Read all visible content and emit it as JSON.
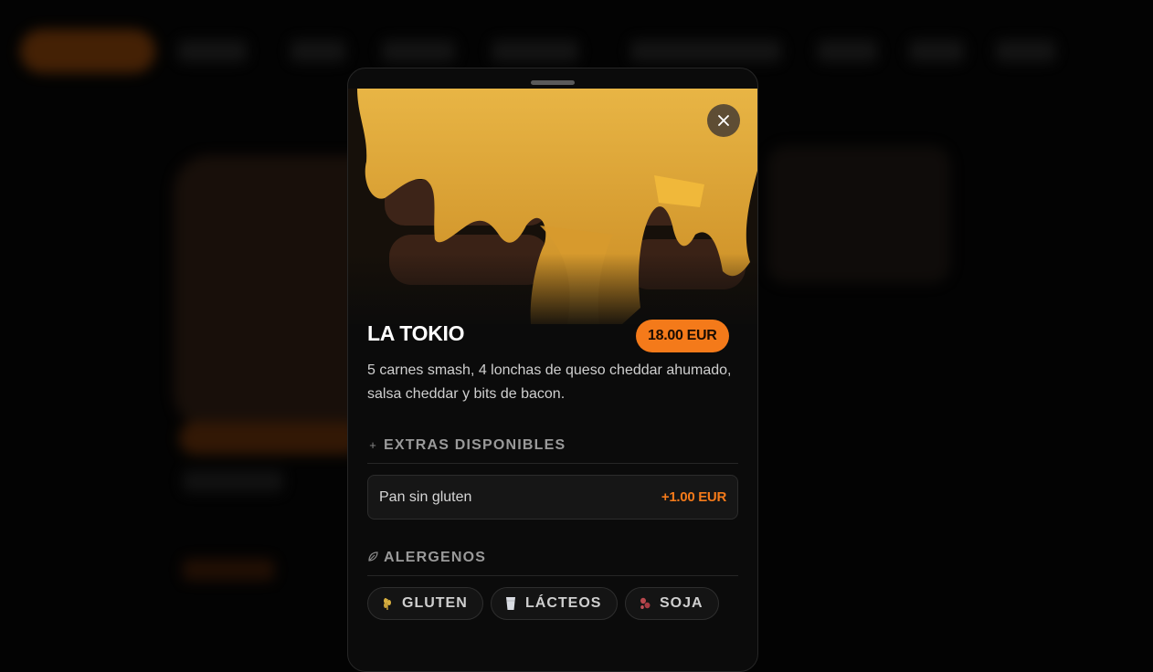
{
  "product": {
    "title": "LA TOKIO",
    "price": "18.00 EUR",
    "description": "5 carnes smash, 4 lonchas de queso cheddar ahumado, salsa cheddar y bits de bacon."
  },
  "extras": {
    "icon": "plus-icon",
    "title": "EXTRAS DISPONIBLES",
    "items": [
      {
        "name": "Pan sin gluten",
        "price": "+1.00 EUR"
      }
    ]
  },
  "allergens": {
    "icon": "leaf-icon",
    "title": "ALERGENOS",
    "items": [
      {
        "label": "GLUTEN",
        "icon": "wheat-icon"
      },
      {
        "label": "LÁCTEOS",
        "icon": "milk-glass-icon"
      },
      {
        "label": "SOJA",
        "icon": "soy-bean-icon"
      }
    ]
  },
  "colors": {
    "accent": "#f47a1a",
    "modal_background": "#0b0b0b",
    "page_background": "#030303"
  }
}
